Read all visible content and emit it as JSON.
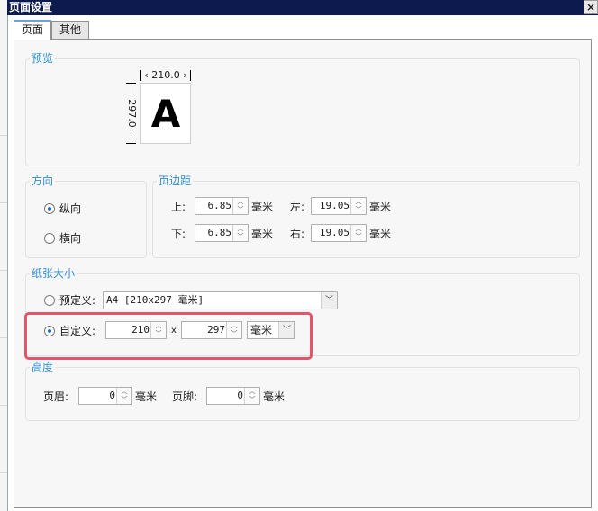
{
  "window": {
    "title": "页面设置",
    "close_glyph": "×"
  },
  "tabs": [
    {
      "label": "页面",
      "active": true
    },
    {
      "label": "其他",
      "active": false
    }
  ],
  "preview": {
    "label": "预览",
    "width_label": "210.0",
    "height_label": "297.0",
    "letter": "A"
  },
  "orientation": {
    "label": "方向",
    "options": [
      {
        "label": "纵向",
        "checked": true
      },
      {
        "label": "横向",
        "checked": false
      }
    ]
  },
  "margins": {
    "label": "页边距",
    "top": {
      "label": "上:",
      "value": "6.85",
      "unit": "毫米"
    },
    "left": {
      "label": "左:",
      "value": "19.05",
      "unit": "毫米"
    },
    "bottom": {
      "label": "下:",
      "value": "6.85",
      "unit": "毫米"
    },
    "right": {
      "label": "右:",
      "value": "19.05",
      "unit": "毫米"
    }
  },
  "paper_size": {
    "label": "纸张大小",
    "predefined": {
      "label": "预定义:",
      "checked": false,
      "value": "A4 [210x297 毫米]"
    },
    "custom": {
      "label": "自定义:",
      "checked": true,
      "width": "210",
      "separator": "x",
      "height": "297",
      "unit": "毫米"
    }
  },
  "height": {
    "label": "高度",
    "header": {
      "label": "页眉:",
      "value": "0",
      "unit": "毫米"
    },
    "footer": {
      "label": "页脚:",
      "value": "0",
      "unit": "毫米"
    }
  },
  "glyphs": {
    "up": "︿",
    "down": "﹀",
    "dropdown": "﹀"
  },
  "colors": {
    "title_bar": "#0d1a4e",
    "group_label": "#2e8fd6",
    "highlight": "#e7546a"
  }
}
